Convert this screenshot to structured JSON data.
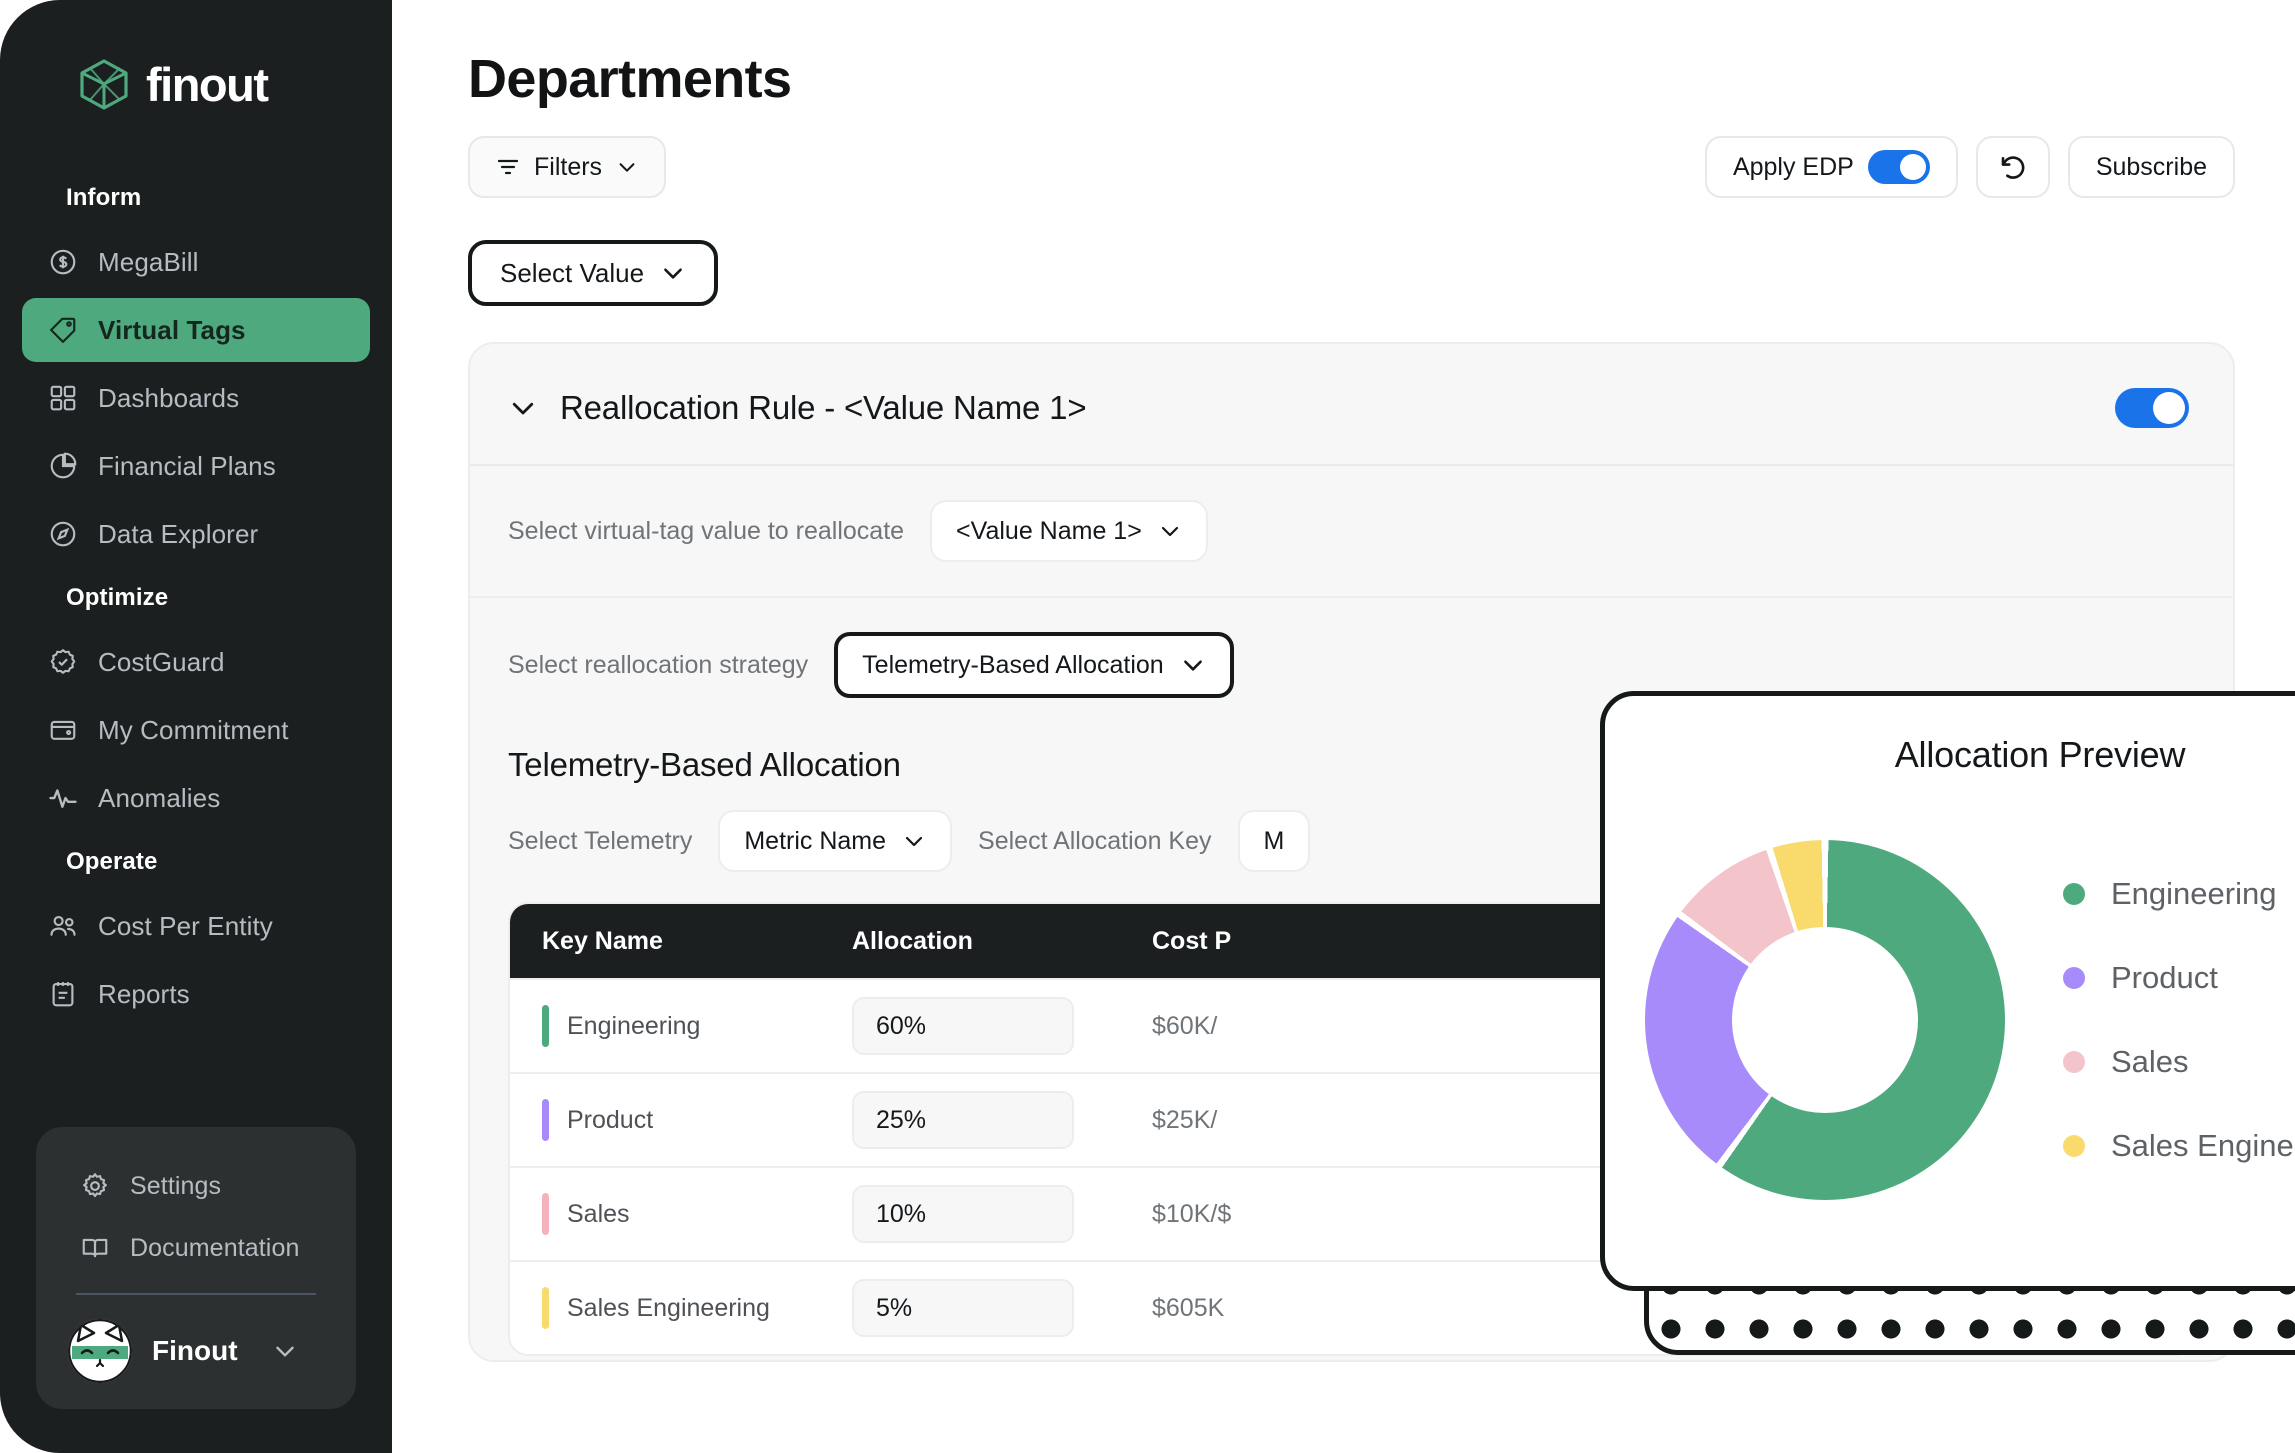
{
  "sidebar": {
    "brand": "finout",
    "groups": [
      {
        "label": "Inform",
        "items": [
          {
            "label": "MegaBill",
            "icon": "dollar-circle-icon",
            "active": false
          },
          {
            "label": "Virtual Tags",
            "icon": "tag-icon",
            "active": true
          },
          {
            "label": "Dashboards",
            "icon": "grid-icon",
            "active": false
          },
          {
            "label": "Financial Plans",
            "icon": "pie-chart-icon",
            "active": false
          },
          {
            "label": "Data Explorer",
            "icon": "compass-icon",
            "active": false
          }
        ]
      },
      {
        "label": "Optimize",
        "items": [
          {
            "label": "CostGuard",
            "icon": "badge-check-icon",
            "active": false
          },
          {
            "label": "My Commitment",
            "icon": "wallet-icon",
            "active": false
          },
          {
            "label": "Anomalies",
            "icon": "pulse-icon",
            "active": false
          }
        ]
      },
      {
        "label": "Operate",
        "items": [
          {
            "label": "Cost Per Entity",
            "icon": "users-icon",
            "active": false
          },
          {
            "label": "Reports",
            "icon": "clipboard-icon",
            "active": false
          }
        ]
      }
    ],
    "bottom": {
      "items": [
        {
          "label": "Settings",
          "icon": "gear-icon"
        },
        {
          "label": "Documentation",
          "icon": "book-icon"
        }
      ],
      "profile_name": "Finout"
    },
    "accent_color": "#4fa97f"
  },
  "header": {
    "title": "Departments",
    "filters_label": "Filters",
    "apply_edp_label": "Apply EDP",
    "apply_edp_on": true,
    "refresh_icon": "undo-icon",
    "subscribe_label": "Subscribe",
    "select_value_label": "Select Value",
    "toggle_color": "#1a73e8"
  },
  "rule_card": {
    "title": "Reallocation Rule - <Value Name 1>",
    "enabled": true,
    "virtual_tag_label": "Select virtual-tag value to reallocate",
    "virtual_tag_value": "<Value Name 1>",
    "strategy_label": "Select reallocation strategy",
    "strategy_value": "Telemetry-Based Allocation",
    "section_title": "Telemetry-Based Allocation",
    "telemetry_label": "Select Telemetry",
    "telemetry_value": "Metric Name",
    "allocation_key_label": "Select Allocation Key",
    "allocation_key_value": "M"
  },
  "table": {
    "columns": [
      "Key Name",
      "Allocation",
      "Cost P"
    ],
    "rows": [
      {
        "key": "Engineering",
        "allocation": "60%",
        "cost": "$60K/",
        "color": "#4fa97f"
      },
      {
        "key": "Product",
        "allocation": "25%",
        "cost": "$25K/",
        "color": "#a78bfa"
      },
      {
        "key": "Sales",
        "allocation": "10%",
        "cost": "$10K/$",
        "color": "#f4b3bb"
      },
      {
        "key": "Sales Engineering",
        "allocation": "5%",
        "cost": "$605K",
        "color": "#f9db6d"
      }
    ]
  },
  "preview": {
    "title": "Allocation Preview"
  },
  "chart_data": {
    "type": "pie",
    "title": "Allocation Preview",
    "categories": [
      "Engineering",
      "Product",
      "Sales",
      "Sales Engineering"
    ],
    "values": [
      60,
      25,
      10,
      5
    ],
    "unit": "%",
    "colors": [
      "#4fa97f",
      "#a78bfa",
      "#f4c4cb",
      "#f9db6d"
    ],
    "donut": true,
    "inner_radius_ratio": 0.52,
    "legend_position": "right",
    "start_angle": 0,
    "grid": false
  }
}
